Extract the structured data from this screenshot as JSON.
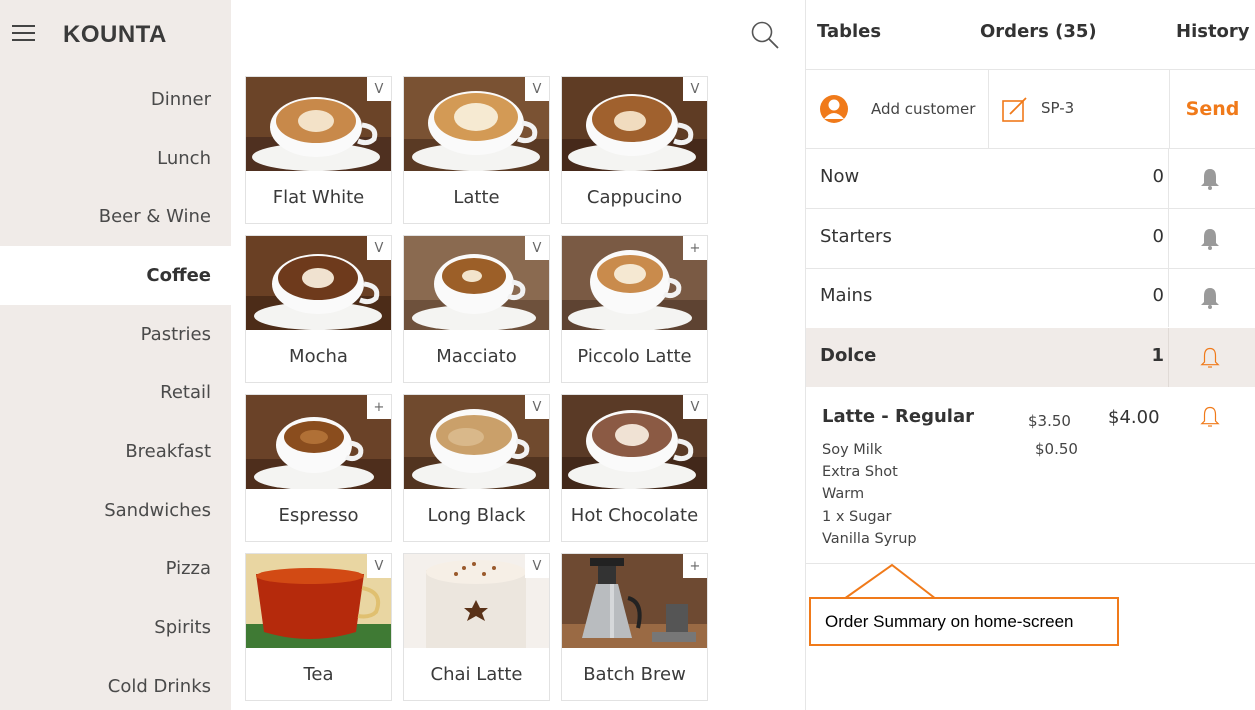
{
  "app": {
    "brand": "KOUNTA"
  },
  "sidebar": {
    "categories": [
      {
        "label": "Dinner"
      },
      {
        "label": "Lunch"
      },
      {
        "label": "Beer & Wine"
      },
      {
        "label": "Coffee",
        "active": true
      },
      {
        "label": "Pastries"
      },
      {
        "label": "Retail"
      },
      {
        "label": "Breakfast"
      },
      {
        "label": "Sandwiches"
      },
      {
        "label": "Pizza"
      },
      {
        "label": "Spirits"
      },
      {
        "label": "Cold Drinks"
      }
    ]
  },
  "products": [
    {
      "name": "Flat White",
      "corner": "V"
    },
    {
      "name": "Latte",
      "corner": "V"
    },
    {
      "name": "Cappucino",
      "corner": "V"
    },
    {
      "name": "Mocha",
      "corner": "V"
    },
    {
      "name": "Macciato",
      "corner": "V"
    },
    {
      "name": "Piccolo Latte",
      "corner": "+"
    },
    {
      "name": "Espresso",
      "corner": "+"
    },
    {
      "name": "Long Black",
      "corner": "V"
    },
    {
      "name": "Hot Chocolate",
      "corner": "V"
    },
    {
      "name": "Tea",
      "corner": "V"
    },
    {
      "name": "Chai Latte",
      "corner": "V"
    },
    {
      "name": "Batch Brew",
      "corner": "+"
    }
  ],
  "order_panel": {
    "tabs": {
      "tables": "Tables",
      "orders": "Orders (35)",
      "history": "History"
    },
    "customer_label": "Add customer",
    "order_ref": "SP-3",
    "send_label": "Send",
    "courses": [
      {
        "name": "Now",
        "count": "0"
      },
      {
        "name": "Starters",
        "count": "0"
      },
      {
        "name": "Mains",
        "count": "0"
      },
      {
        "name": "Dolce",
        "count": "1"
      }
    ],
    "item": {
      "name": "Latte - Regular",
      "base_price": "$3.50",
      "total": "$4.00",
      "modifiers": [
        "Soy Milk",
        "Extra Shot",
        "Warm",
        "1 x Sugar",
        "Vanilla Syrup"
      ],
      "modifier_price": "$0.50"
    }
  },
  "annotation": {
    "text": "Order Summary on home-screen"
  },
  "colors": {
    "accent": "#f07a1a",
    "sidebar_bg": "#f0ebe8",
    "bell_grey": "#9a9a9a"
  }
}
